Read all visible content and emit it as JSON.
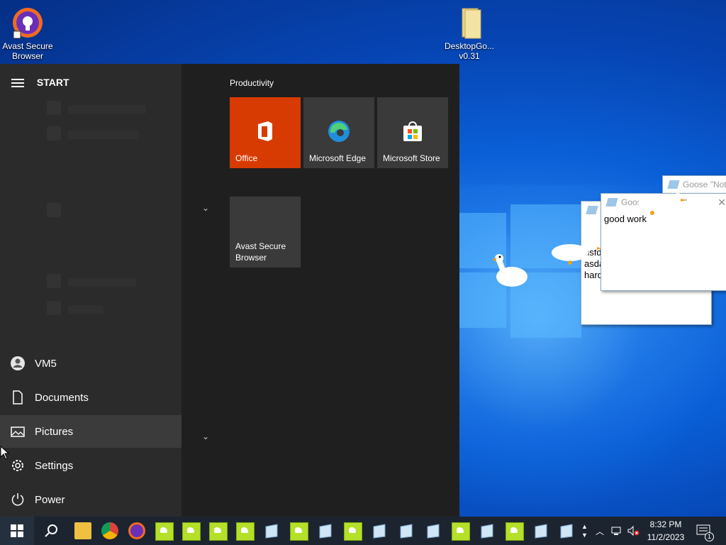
{
  "desktop": {
    "icons": [
      {
        "label": "Avast Secure Browser",
        "label_line1": "Avast Secure",
        "label_line2": "Browser"
      },
      {
        "label": "DesktopGo... v0.31",
        "label_line1": "DesktopGo...",
        "label_line2": "v0.31"
      }
    ]
  },
  "start_menu": {
    "header": "START",
    "group_title": "Productivity",
    "tiles": [
      {
        "label": "Office",
        "icon": "office-icon",
        "color": "#d83b01"
      },
      {
        "label": "Microsoft Edge",
        "icon": "edge-icon"
      },
      {
        "label": "Microsoft Store",
        "icon": "store-icon"
      },
      {
        "label_line1": "Avast Secure",
        "label_line2": "Browser"
      }
    ],
    "nav": [
      {
        "label": "VM5",
        "icon": "user-icon"
      },
      {
        "label": "Documents",
        "icon": "document-icon"
      },
      {
        "label": "Pictures",
        "icon": "pictures-icon",
        "active": true
      },
      {
        "label": "Settings",
        "icon": "gear-icon"
      },
      {
        "label": "Power",
        "icon": "power-icon"
      }
    ]
  },
  "goose_windows": {
    "back_title": "Goose \"Not",
    "mid_lines": [
      "nsfd",
      "asda",
      "hard"
    ],
    "front_title_left": "Goos",
    "front_title_right": "\"",
    "front_body": "good work"
  },
  "taskbar": {
    "clock_time": "8:32 PM",
    "clock_date": "11/2/2023",
    "notification_count": "1"
  },
  "colors": {
    "accent_office": "#d83b01",
    "taskbar_bg": "#1c2430",
    "start_bg": "#1f1f1f"
  }
}
